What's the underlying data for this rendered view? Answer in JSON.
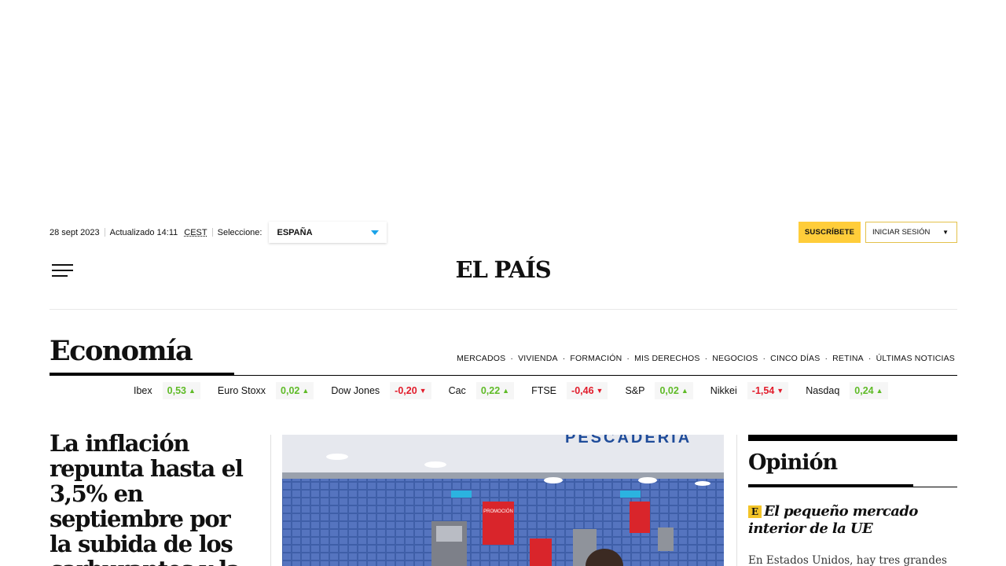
{
  "topbar": {
    "date": "28 sept 2023",
    "updated": "Actualizado 14:11",
    "timezone": "CEST",
    "select_label": "Seleccione:",
    "edition": "ESPAÑA",
    "subscribe": "SUSCRÍBETE",
    "login": "INICIAR SESIÓN",
    "login_caret": "▼"
  },
  "header": {
    "logo": "EL PAÍS"
  },
  "section": {
    "title": "Economía",
    "subnav": [
      "MERCADOS",
      "VIVIENDA",
      "FORMACIÓN",
      "MIS DERECHOS",
      "NEGOCIOS",
      "CINCO DÍAS",
      "RETINA",
      "ÚLTIMAS NOTICIAS"
    ]
  },
  "ticker": [
    {
      "name": "Ibex",
      "value": "0,53",
      "dir": "up"
    },
    {
      "name": "Euro Stoxx",
      "value": "0,02",
      "dir": "up"
    },
    {
      "name": "Dow Jones",
      "value": "-0,20",
      "dir": "down"
    },
    {
      "name": "Cac",
      "value": "0,22",
      "dir": "up"
    },
    {
      "name": "FTSE",
      "value": "-0,46",
      "dir": "down"
    },
    {
      "name": "S&P",
      "value": "0,02",
      "dir": "up"
    },
    {
      "name": "Nikkei",
      "value": "-1,54",
      "dir": "down"
    },
    {
      "name": "Nasdaq",
      "value": "0,24",
      "dir": "up"
    }
  ],
  "lead": {
    "headline": "La inflación repunta hasta el 3,5% en septiembre por la subida de los carburantes y la"
  },
  "photo": {
    "sign_text": "PESCADERÍA",
    "promo_text": "PROMOCIÓN"
  },
  "opinion": {
    "title": "Opinión",
    "badge": "E",
    "headline": "El pequeño mercado interior de la UE",
    "text": "En Estados Unidos, hay tres grandes"
  },
  "colors": {
    "accent_yellow": "#ffcd3a",
    "up_green": "#5fbb27",
    "down_red": "#e21b2a",
    "edition_caret": "#1aa3e8"
  }
}
